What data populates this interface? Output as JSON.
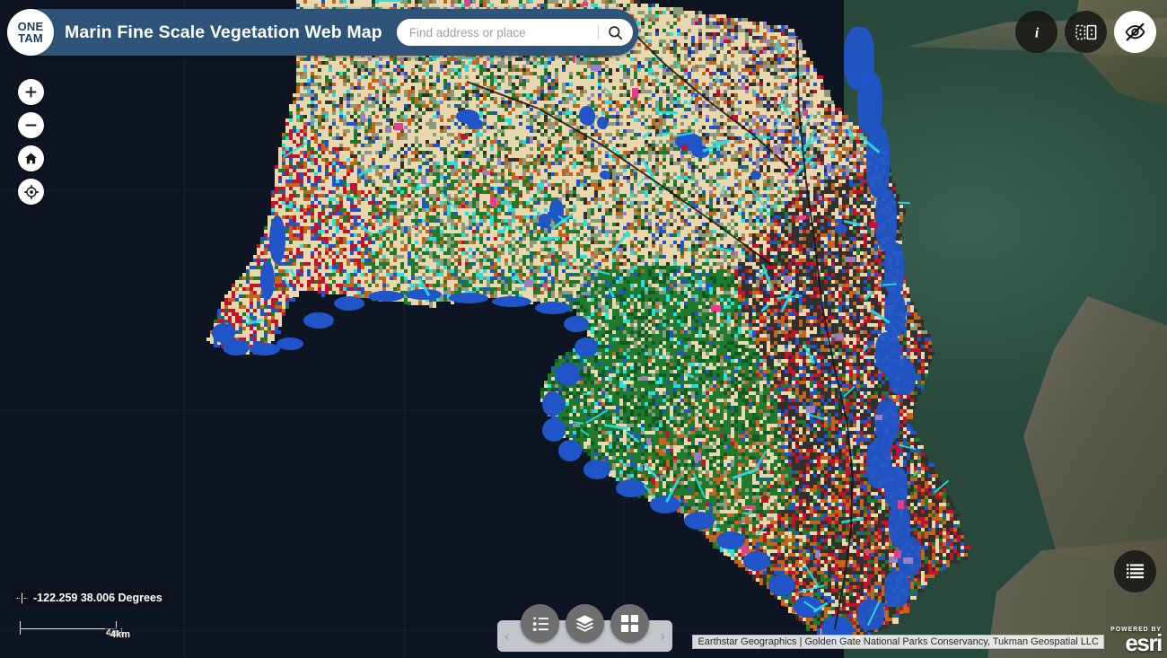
{
  "header": {
    "logo_line1": "ONE",
    "logo_line2": "TAM",
    "logo_name": "one-tam-logo",
    "title": "Marin Fine Scale Vegetation Web Map",
    "search": {
      "placeholder": "Find address or place",
      "value": "",
      "search_icon": "search-icon"
    }
  },
  "top_right_tools": [
    {
      "name": "about-info-button",
      "icon": "info-icon",
      "glyph": "i",
      "style": "dark",
      "tooltip": "About"
    },
    {
      "name": "swipe-compare-button",
      "icon": "swipe-compare-icon",
      "style": "dark",
      "tooltip": "Swipe"
    },
    {
      "name": "hide-layers-button",
      "icon": "eye-slash-icon",
      "style": "light",
      "tooltip": "Hide map layers"
    }
  ],
  "map_nav": [
    {
      "name": "zoom-in-button",
      "icon": "plus-icon",
      "label": "+"
    },
    {
      "name": "zoom-out-button",
      "icon": "minus-icon",
      "label": "−"
    },
    {
      "name": "home-button",
      "icon": "home-icon",
      "label": ""
    },
    {
      "name": "locate-button",
      "icon": "locate-crosshair-icon",
      "label": ""
    }
  ],
  "coordinates": {
    "icon": "coordinate-crosshair-icon",
    "text": "-122.259 38.006 Degrees",
    "longitude": "-122.259",
    "latitude": "38.006",
    "unit": "Degrees"
  },
  "scalebar": {
    "miles_label": "4mi",
    "km_label": "4km"
  },
  "widget_bar": {
    "prev_chevron": "‹",
    "next_chevron": "›",
    "buttons": [
      {
        "name": "legend-button",
        "icon": "legend-list-icon",
        "tooltip": "Legend"
      },
      {
        "name": "layer-list-button",
        "icon": "layers-stack-icon",
        "tooltip": "Layer List"
      },
      {
        "name": "basemap-gallery-button",
        "icon": "basemap-grid-icon",
        "tooltip": "Basemap Gallery"
      }
    ]
  },
  "table_button": {
    "name": "attribute-table-button",
    "icon": "table-list-icon",
    "tooltip": "Attribute Table"
  },
  "attribution": {
    "text": "Earthstar Geographics | Golden Gate National Parks Conservancy, Tukman Geospatial LLC"
  },
  "esri": {
    "powered_by": "POWERED BY",
    "wordmark": "esri"
  },
  "colors": {
    "header_blue": "#2e5579",
    "logo_navy": "#1d3e60",
    "ocean": "#0e1522",
    "bay_water": "#2e5246",
    "veg_grassland": "#e9d7ae",
    "veg_forest": "#1f7a2e",
    "veg_conifer": "#0f5a22",
    "veg_shrub": "#c4641a",
    "veg_water": "#1f55c8",
    "veg_riparian": "#25e0e0",
    "veg_urban": "#32302c",
    "veg_developed_red": "#c4122c",
    "veg_oak": "#8a9a7a",
    "veg_purple": "#9b7fc4",
    "widget_bar_gray": "#c3c6cb",
    "widget_circle_gray": "#6e6e6e"
  },
  "map": {
    "name": "marin-county-vegetation-map",
    "basemap": "imagery-satellite",
    "operational_layer": "marin-fine-scale-vegetation"
  }
}
